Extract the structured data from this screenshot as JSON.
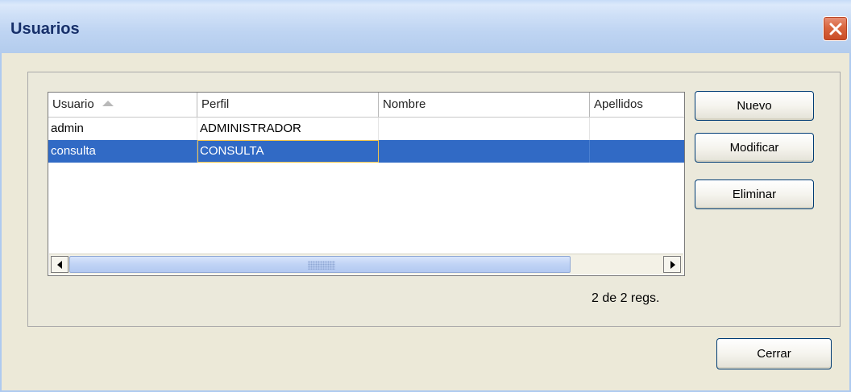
{
  "window": {
    "title": "Usuarios"
  },
  "table": {
    "columns": [
      {
        "label": "Usuario"
      },
      {
        "label": "Perfil"
      },
      {
        "label": "Nombre"
      },
      {
        "label": "Apellidos"
      }
    ],
    "rows": [
      {
        "usuario": "admin",
        "perfil": "ADMINISTRADOR",
        "nombre": "",
        "apellidos": "",
        "selected": false
      },
      {
        "usuario": "consulta",
        "perfil": "CONSULTA",
        "nombre": "",
        "apellidos": "",
        "selected": true
      }
    ]
  },
  "actions": {
    "nuevo": "Nuevo",
    "modificar": "Modificar",
    "eliminar": "Eliminar",
    "cerrar": "Cerrar"
  },
  "status": {
    "record_count": "2 de 2 regs."
  },
  "icons": {
    "close": "close-icon",
    "sort": "sort-ascending-icon",
    "scroll_left": "arrow-left-icon",
    "scroll_right": "arrow-right-icon"
  },
  "colors": {
    "selection": "#316ac5",
    "focus": "#f3c44a",
    "title_text": "#17306a",
    "close_button": "#d9663f"
  }
}
